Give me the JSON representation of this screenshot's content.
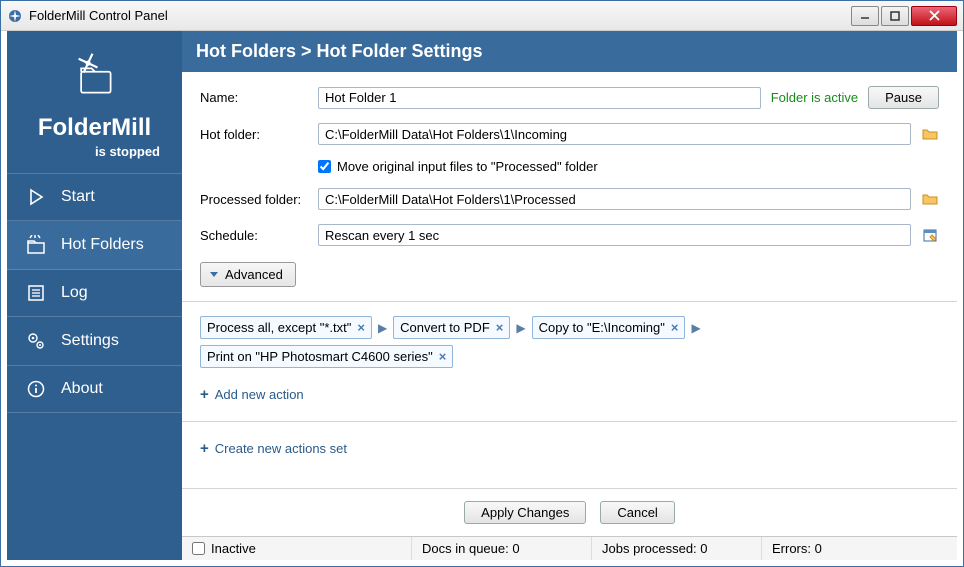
{
  "window": {
    "title": "FolderMill Control Panel"
  },
  "brand": {
    "name": "FolderMill",
    "status": "is stopped"
  },
  "nav": {
    "start": "Start",
    "hotfolders": "Hot Folders",
    "log": "Log",
    "settings": "Settings",
    "about": "About"
  },
  "header": {
    "breadcrumb": "Hot Folders  >  Hot Folder Settings"
  },
  "form": {
    "name_label": "Name:",
    "name_value": "Hot Folder 1",
    "folder_status": "Folder is active",
    "pause_label": "Pause",
    "hotfolder_label": "Hot folder:",
    "hotfolder_value": "C:\\FolderMill Data\\Hot Folders\\1\\Incoming",
    "move_checkbox": "Move original input files to \"Processed\" folder",
    "processed_label": "Processed folder:",
    "processed_value": "C:\\FolderMill Data\\Hot Folders\\1\\Processed",
    "schedule_label": "Schedule:",
    "schedule_value": "Rescan every 1 sec",
    "advanced_label": "Advanced"
  },
  "actions": {
    "chips": [
      "Process all, except \"*.txt\"",
      "Convert to PDF",
      "Copy to \"E:\\Incoming\"",
      "Print on \"HP Photosmart C4600 series\""
    ],
    "add_action": "Add new action",
    "create_set": "Create new actions set"
  },
  "footer": {
    "apply": "Apply Changes",
    "cancel": "Cancel"
  },
  "statusbar": {
    "inactive": "Inactive",
    "docs": "Docs in queue: 0",
    "jobs": "Jobs processed: 0",
    "errors": "Errors: 0"
  }
}
